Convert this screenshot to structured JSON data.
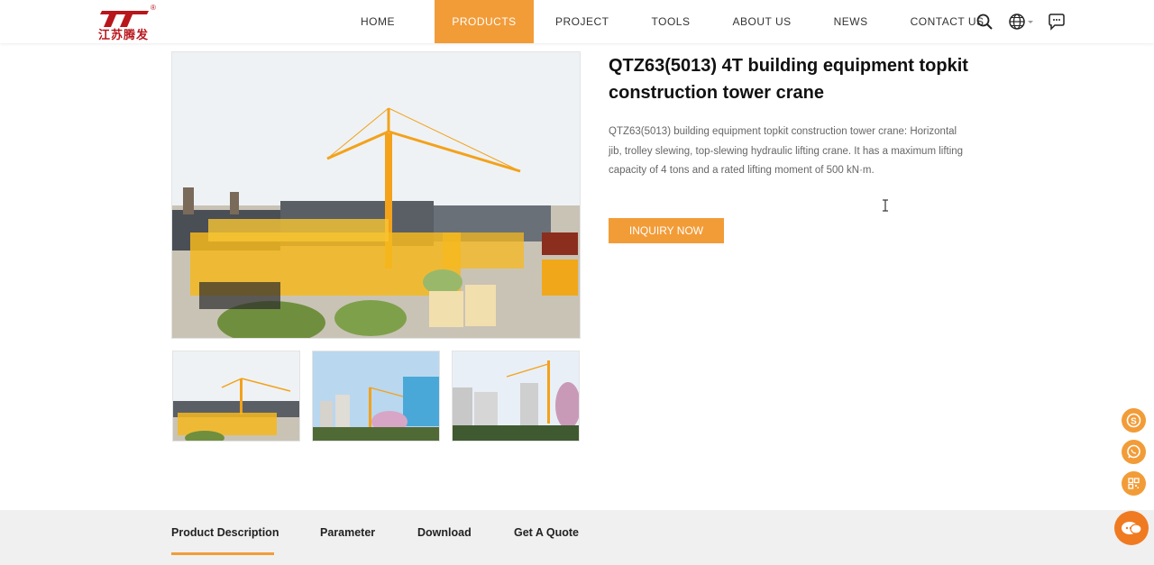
{
  "header": {
    "logo_text": "江苏腾发",
    "logo_mark": "®",
    "nav": [
      {
        "label": "HOME",
        "active": false
      },
      {
        "label": "PRODUCTS",
        "active": true
      },
      {
        "label": "PROJECT",
        "active": false
      },
      {
        "label": "TOOLS",
        "active": false
      },
      {
        "label": "ABOUT US",
        "active": false
      },
      {
        "label": "NEWS",
        "active": false
      },
      {
        "label": "CONTACT US",
        "active": false
      }
    ],
    "icons": [
      "search-icon",
      "globe-icon",
      "chat-icon"
    ]
  },
  "product": {
    "title": "QTZ63(5013) 4T building equipment topkit construction tower crane",
    "description": "QTZ63(5013) building equipment topkit construction tower crane: Horizontal jib, trolley slewing, top-slewing hydraulic lifting crane. It has a maximum lifting capacity of 4 tons and a rated lifting moment of 500 kN·m.",
    "inquiry_label": "INQUIRY NOW"
  },
  "tabs": [
    {
      "label": "Product Description",
      "active": true
    },
    {
      "label": "Parameter",
      "active": false
    },
    {
      "label": "Download",
      "active": false
    },
    {
      "label": "Get A Quote",
      "active": false
    }
  ],
  "floating": [
    "skype-icon",
    "whatsapp-icon",
    "qr-code-icon",
    "online-chat-icon"
  ],
  "colors": {
    "accent": "#f29c38",
    "brand_red": "#b8161c",
    "tab_band": "#f0f0f0"
  }
}
